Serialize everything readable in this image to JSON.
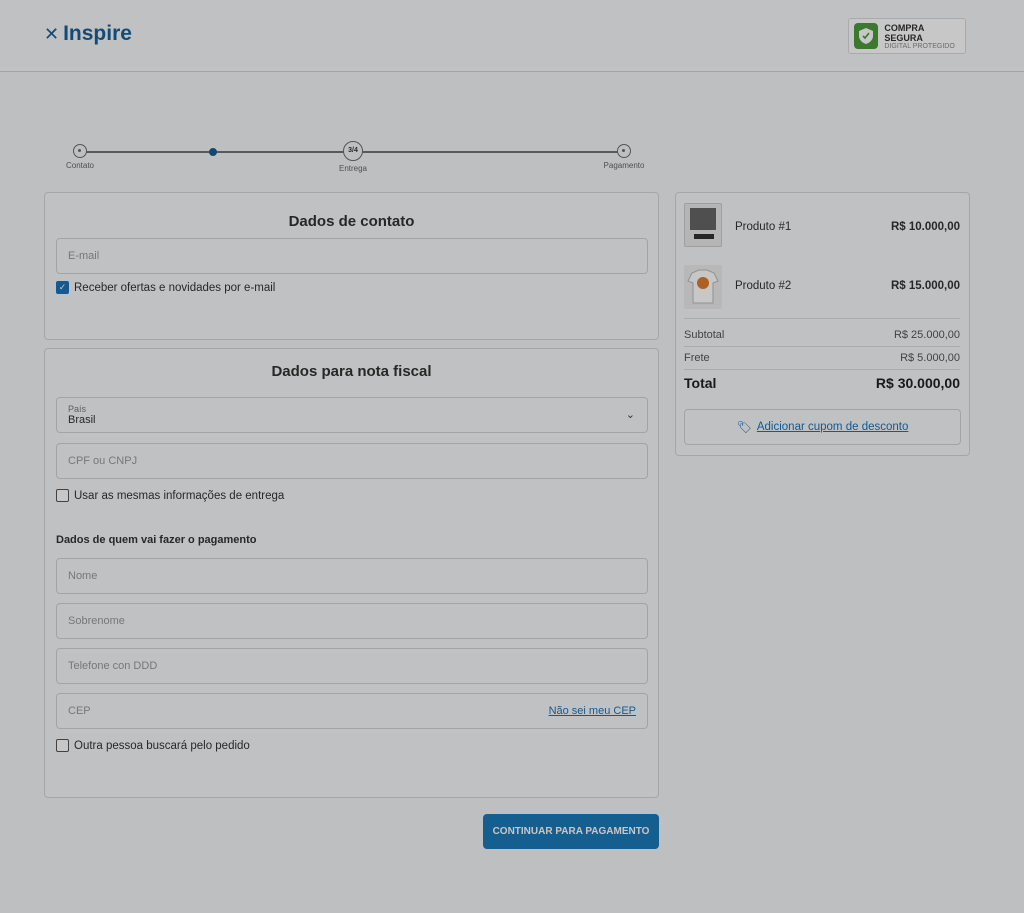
{
  "header": {
    "logo_text": "Inspire",
    "secure_badge": {
      "line1": "COMPRA SEGURA",
      "line2": "DIGITAL PROTEGIDO"
    }
  },
  "stepper": {
    "steps": [
      {
        "label": "Contato"
      },
      {
        "label": ""
      },
      {
        "label": "Entrega",
        "badge": "3/4"
      },
      {
        "label": "Pagamento"
      }
    ]
  },
  "contact": {
    "title": "Dados de contato",
    "email_placeholder": "E-mail",
    "offers_label": "Receber ofertas e novidades por e-mail"
  },
  "invoice": {
    "title": "Dados para nota fiscal",
    "country_label": "País",
    "country_value": "Brasil",
    "cpf_placeholder": "CPF ou CNPJ",
    "same_info_label": "Usar as mesmas informações de entrega",
    "payer_heading": "Dados de quem vai fazer o pagamento",
    "name_placeholder": "Nome",
    "surname_placeholder": "Sobrenome",
    "phone_placeholder": "Telefone con DDD",
    "cep_placeholder": "CEP",
    "cep_link": "Não sei meu CEP",
    "other_person_label": "Outra pessoa buscará pelo pedido"
  },
  "summary": {
    "products": [
      {
        "name": "Produto #1",
        "price": "R$ 10.000,00"
      },
      {
        "name": "Produto #2",
        "price": "R$ 15.000,00"
      }
    ],
    "subtotal_label": "Subtotal",
    "subtotal_value": "R$ 25.000,00",
    "shipping_label": "Frete",
    "shipping_value": "R$ 5.000,00",
    "total_label": "Total",
    "total_value": "R$ 30.000,00",
    "coupon_link": "Adicionar cupom de desconto"
  },
  "actions": {
    "continue_label": "CONTINUAR PARA PAGAMENTO"
  },
  "colors": {
    "primary": "#1a7ab8",
    "brand": "#1b5f96",
    "secure_green": "#4e9a3a"
  }
}
